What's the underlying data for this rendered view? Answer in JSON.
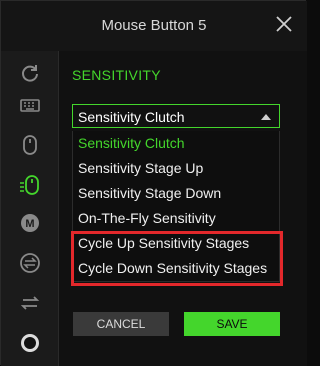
{
  "window": {
    "title": "Mouse Button 5"
  },
  "sidebar": {
    "items": [
      {
        "icon": "refresh-icon",
        "active": false
      },
      {
        "icon": "keyboard-icon",
        "active": false
      },
      {
        "icon": "mouse-icon",
        "active": false
      },
      {
        "icon": "mouse-sensitivity-icon",
        "active": true
      },
      {
        "icon": "macro-m-icon",
        "active": false
      },
      {
        "icon": "switch-profile-icon",
        "active": false
      },
      {
        "icon": "swap-arrows-icon",
        "active": false
      },
      {
        "icon": "circle-icon",
        "active": false
      }
    ]
  },
  "main": {
    "section_title": "SENSITIVITY",
    "dropdown": {
      "selected": "Sensitivity Clutch",
      "options": [
        "Sensitivity Clutch",
        "Sensitivity Stage Up",
        "Sensitivity Stage Down",
        "On-The-Fly Sensitivity",
        "Cycle Up Sensitivity Stages",
        "Cycle Down Sensitivity Stages"
      ]
    },
    "buttons": {
      "cancel": "CANCEL",
      "save": "SAVE"
    }
  },
  "colors": {
    "accent": "#44d62c",
    "highlight": "#e3282b",
    "background": "#111111"
  }
}
